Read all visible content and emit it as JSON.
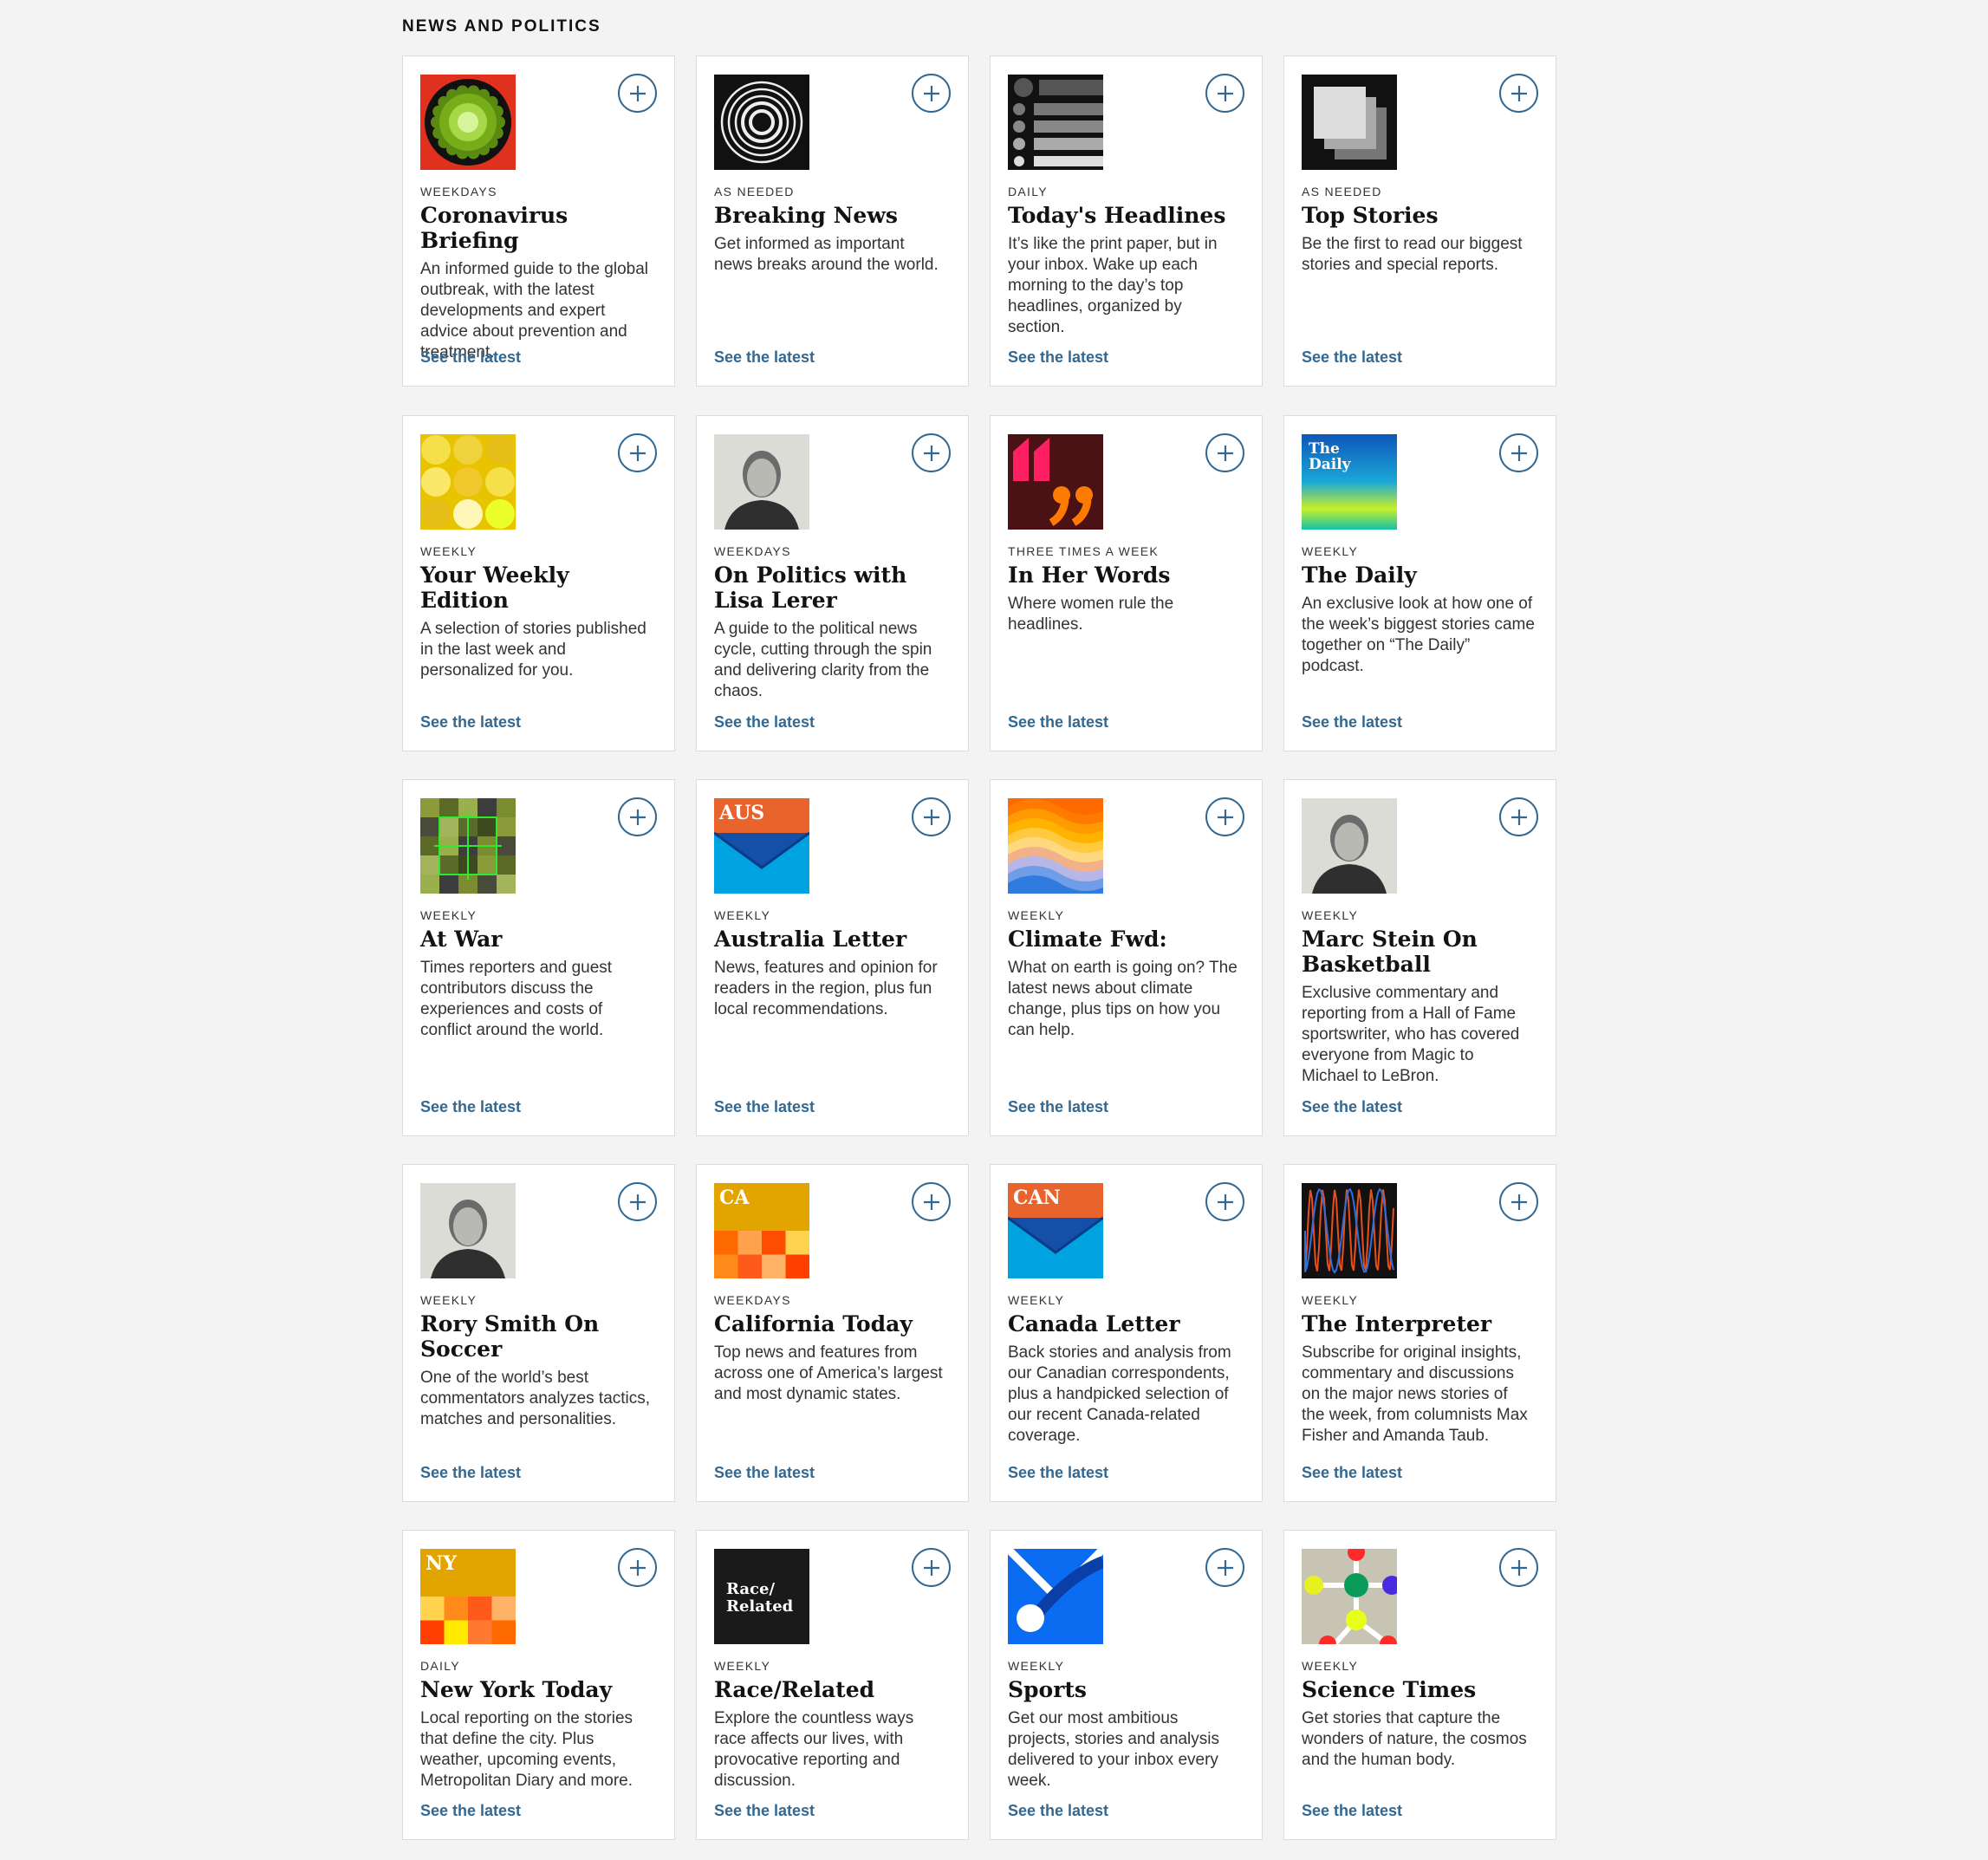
{
  "section": {
    "title": "NEWS AND POLITICS"
  },
  "cards": [
    {
      "freq": "WEEKDAYS",
      "name": "Coronavirus Briefing",
      "desc": "An informed guide to the global outbreak, with the latest developments and expert advice about prevention and treatment.",
      "link": "See the latest",
      "icon": "coronavirus-icon"
    },
    {
      "freq": "AS NEEDED",
      "name": "Breaking News",
      "desc": "Get informed as important news breaks around the world.",
      "link": "See the latest",
      "icon": "rings-icon"
    },
    {
      "freq": "DAILY",
      "name": "Today's Headlines",
      "desc": "It’s like the print paper, but in your inbox. Wake up each morning to the day’s top headlines, organized by section.",
      "link": "See the latest",
      "icon": "list-icon"
    },
    {
      "freq": "AS NEEDED",
      "name": "Top Stories",
      "desc": "Be the first to read our biggest stories and special reports.",
      "link": "See the latest",
      "icon": "stacked-squares-icon"
    },
    {
      "freq": "WEEKLY",
      "name": "Your Weekly Edition",
      "desc": "A selection of stories published in the last week and personalized for you.",
      "link": "See the latest",
      "icon": "yellow-dots-icon"
    },
    {
      "freq": "WEEKDAYS",
      "name": "On Politics with Lisa Lerer",
      "desc": "A guide to the political news cycle, cutting through the spin and delivering clarity from the chaos.",
      "link": "See the latest",
      "icon": "author-portrait-icon"
    },
    {
      "freq": "THREE TIMES A WEEK",
      "name": "In Her Words",
      "desc": "Where women rule the headlines.",
      "link": "See the latest",
      "icon": "quote-marks-icon"
    },
    {
      "freq": "WEEKLY",
      "name": "The Daily",
      "desc": "An exclusive look at how one of the week’s biggest stories came together on “The Daily” podcast.",
      "link": "See the latest",
      "icon": "the-daily-logo-icon",
      "logo_text": [
        "The",
        "Daily"
      ]
    },
    {
      "freq": "WEEKLY",
      "name": "At War",
      "desc": "Times reporters and guest contributors discuss the experiences and costs of conflict around the world.",
      "link": "See the latest",
      "icon": "crosshair-grid-icon"
    },
    {
      "freq": "WEEKLY",
      "name": "Australia Letter",
      "desc": "News, features and opinion for readers in the region, plus fun local recommendations.",
      "link": "See the latest",
      "icon": "envelope-aus-icon",
      "logo_text": "AUS"
    },
    {
      "freq": "WEEKLY",
      "name": "Climate Fwd:",
      "desc": "What on earth is going on? The latest news about climate change, plus tips on how you can help.",
      "link": "See the latest",
      "icon": "climate-waves-icon"
    },
    {
      "freq": "WEEKLY",
      "name": "Marc Stein On Basketball",
      "desc": "Exclusive commentary and reporting from a Hall of Fame sportswriter, who has covered everyone from Magic to Michael to LeBron.",
      "link": "See the latest",
      "icon": "author-portrait-icon"
    },
    {
      "freq": "WEEKLY",
      "name": "Rory Smith On Soccer",
      "desc": "One of the world’s best commentators analyzes tactics, matches and personalities.",
      "link": "See the latest",
      "icon": "author-portrait-icon"
    },
    {
      "freq": "WEEKDAYS",
      "name": "California Today",
      "desc": "Top news and features from across one of America’s largest and most dynamic states.",
      "link": "See the latest",
      "icon": "california-grid-icon",
      "logo_text": "CA"
    },
    {
      "freq": "WEEKLY",
      "name": "Canada Letter",
      "desc": "Back stories and analysis from our Canadian correspondents, plus a handpicked selection of our recent Canada-related coverage.",
      "link": "See the latest",
      "icon": "envelope-can-icon",
      "logo_text": "CAN"
    },
    {
      "freq": "WEEKLY",
      "name": "The Interpreter",
      "desc": "Subscribe for original insights, commentary and discussions on the major news stories of the week, from columnists Max Fisher and Amanda Taub.",
      "link": "See the latest",
      "icon": "waveform-icon"
    },
    {
      "freq": "DAILY",
      "name": "New York Today",
      "desc": "Local reporting on the stories that define the city. Plus weather, upcoming events, Metropolitan Diary and more.",
      "link": "See the latest",
      "icon": "new-york-grid-icon",
      "logo_text": "NY"
    },
    {
      "freq": "WEEKLY",
      "name": "Race/Related",
      "desc": "Explore the countless ways race affects our lives, with provocative reporting and discussion.",
      "link": "See the latest",
      "icon": "race-related-logo-icon",
      "logo_text": [
        "Race/",
        "Related"
      ]
    },
    {
      "freq": "WEEKLY",
      "name": "Sports",
      "desc": "Get our most ambitious projects, stories and analysis delivered to your inbox every week.",
      "link": "See the latest",
      "icon": "sports-envelope-icon"
    },
    {
      "freq": "WEEKLY",
      "name": "Science Times",
      "desc": "Get stories that capture the wonders of nature, the cosmos and the human body.",
      "link": "See the latest",
      "icon": "molecule-icon"
    }
  ],
  "colors": {
    "link": "#326891",
    "background": "#f3f3f3",
    "card": "#ffffff"
  }
}
